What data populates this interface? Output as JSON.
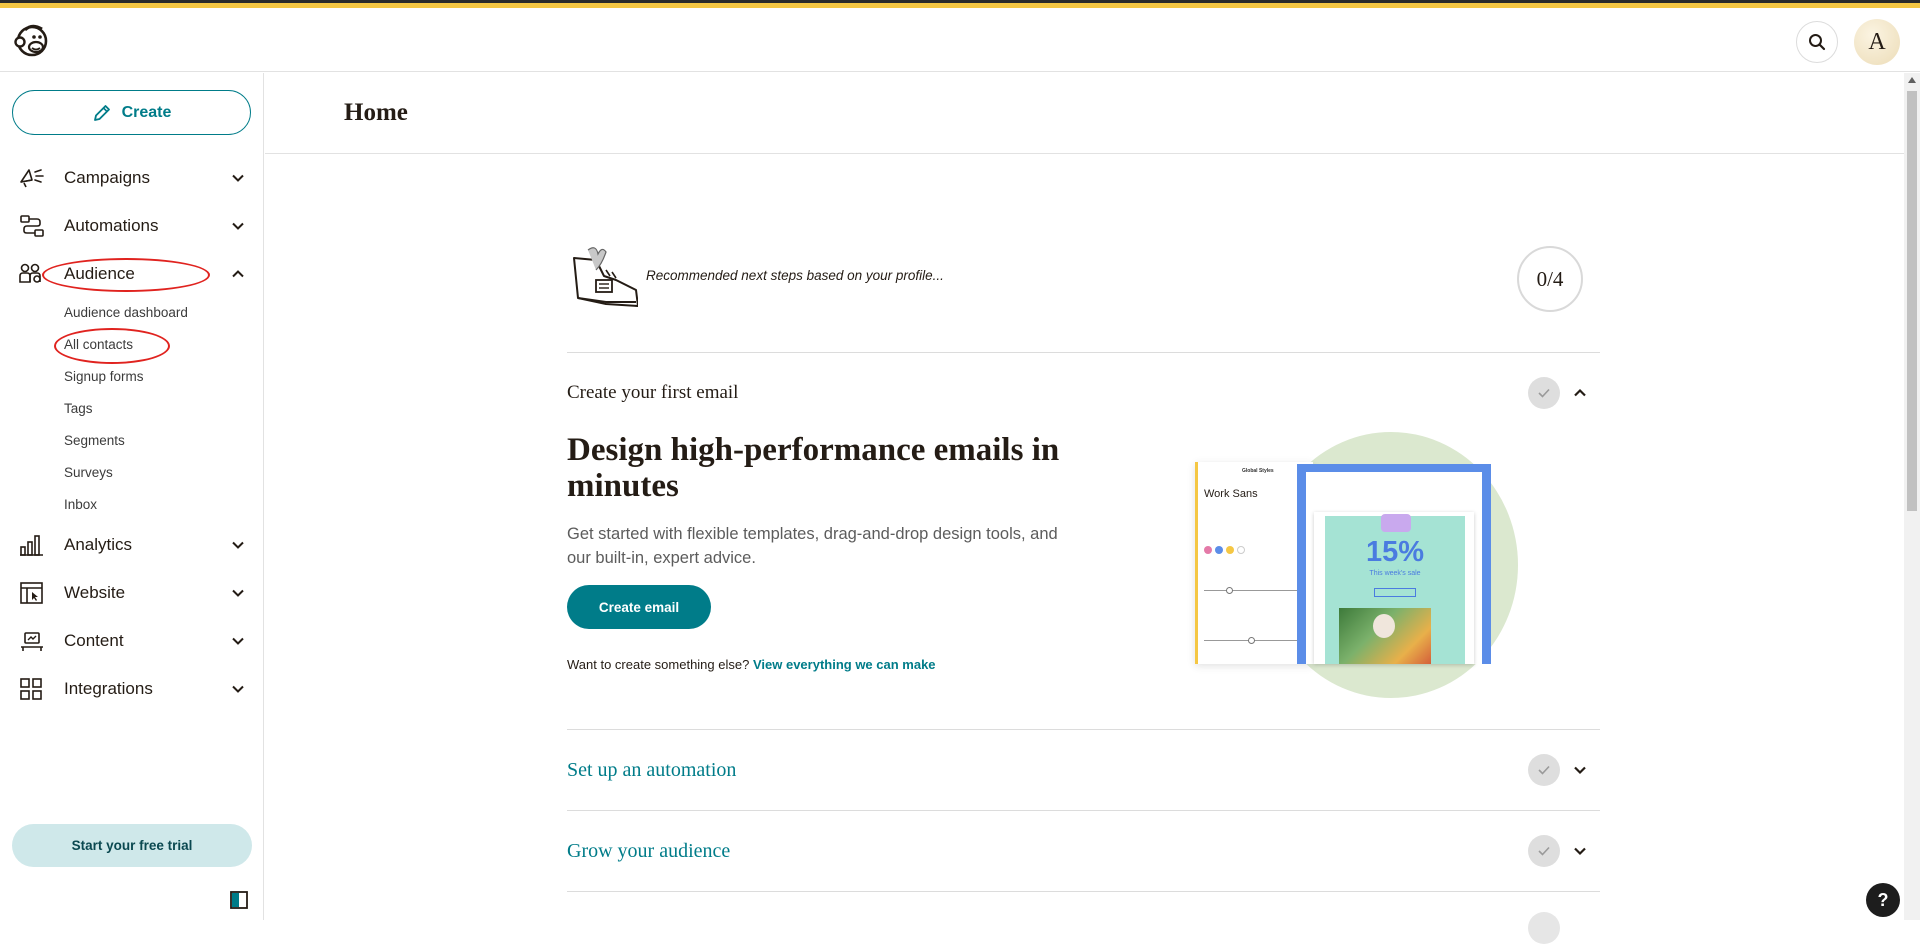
{
  "app": {
    "avatar_initial": "A",
    "accent_color": "#007c89",
    "brand_stripe_color": "#f5c744"
  },
  "sidebar": {
    "create_label": "Create",
    "items": [
      {
        "label": "Campaigns",
        "icon": "megaphone-icon",
        "expanded": false
      },
      {
        "label": "Automations",
        "icon": "workflow-icon",
        "expanded": false
      },
      {
        "label": "Audience",
        "icon": "audience-icon",
        "expanded": true
      },
      {
        "label": "Analytics",
        "icon": "bar-chart-icon",
        "expanded": false
      },
      {
        "label": "Website",
        "icon": "website-icon",
        "expanded": false
      },
      {
        "label": "Content",
        "icon": "content-icon",
        "expanded": false
      },
      {
        "label": "Integrations",
        "icon": "grid-icon",
        "expanded": false
      }
    ],
    "audience_sub": [
      "Audience dashboard",
      "All contacts",
      "Signup forms",
      "Tags",
      "Segments",
      "Surveys",
      "Inbox"
    ],
    "trial_label": "Start your free trial"
  },
  "header": {
    "title": "Home"
  },
  "main": {
    "recommendation_text": "Recommended next steps based on your profile...",
    "progress_text": "0/4",
    "steps": [
      {
        "title": "Create your first email",
        "expanded": true
      },
      {
        "title": "Set up an automation",
        "expanded": false
      },
      {
        "title": "Grow your audience",
        "expanded": false
      }
    ],
    "hero_heading": "Design high-performance emails in minutes",
    "hero_paragraph": "Get started with flexible templates, drag-and-drop design tools, and our built-in, expert advice.",
    "create_email_label": "Create email",
    "else_prompt": "Want to create something else?",
    "else_link": "View everything we can make",
    "preview": {
      "font_name": "Work Sans",
      "panel_title": "Global Styles",
      "discount": "15%",
      "sale_text": "This week's sale"
    }
  },
  "help_label": "?"
}
